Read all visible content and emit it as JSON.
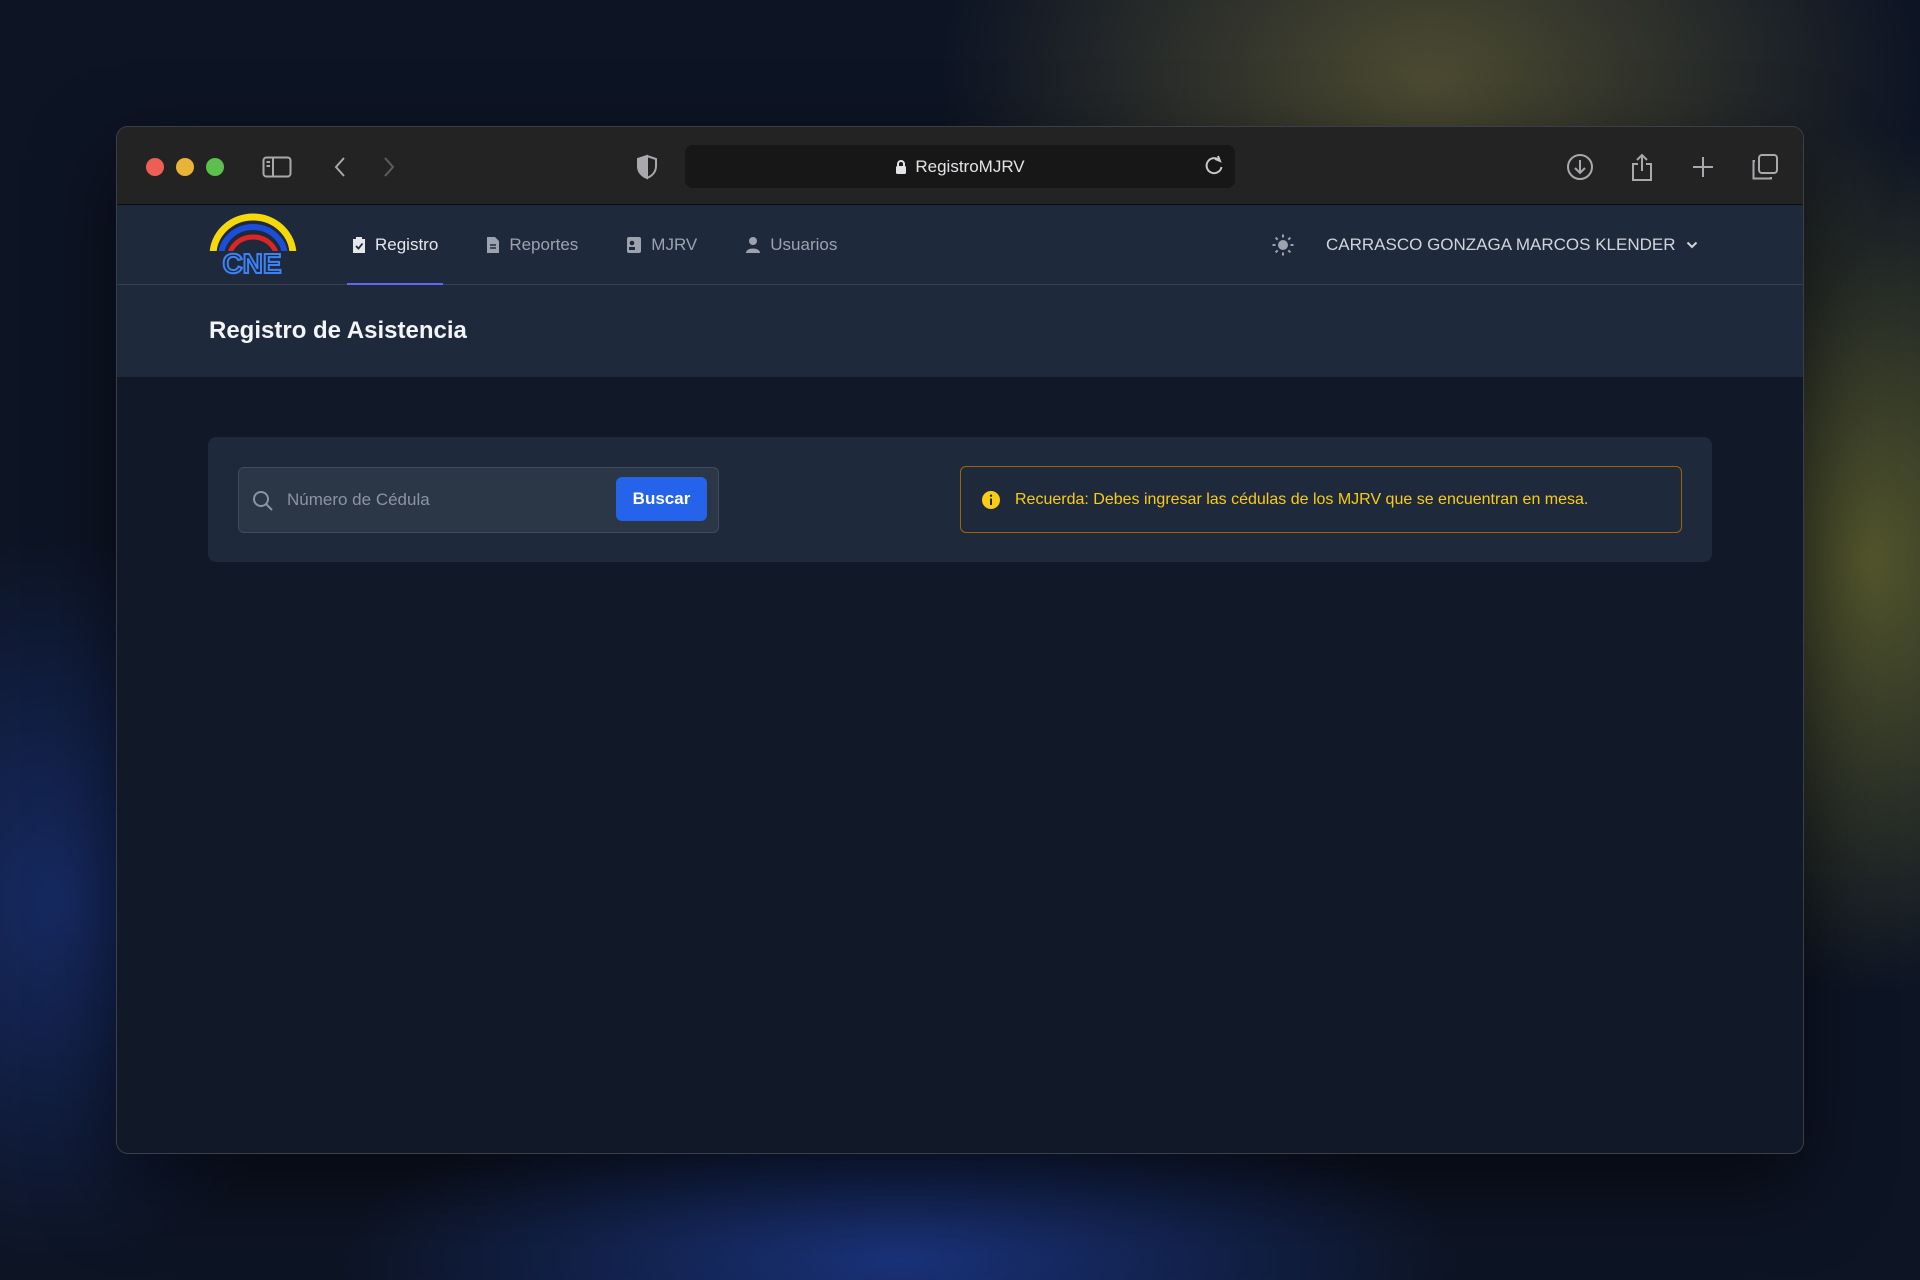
{
  "browser": {
    "url_text": "RegistroMJRV"
  },
  "logo": {
    "text": "CNE"
  },
  "nav": {
    "tabs": [
      {
        "label": "Registro",
        "icon": "clipboard-check-icon",
        "active": true
      },
      {
        "label": "Reportes",
        "icon": "document-icon",
        "active": false
      },
      {
        "label": "MJRV",
        "icon": "id-card-icon",
        "active": false
      },
      {
        "label": "Usuarios",
        "icon": "user-icon",
        "active": false
      }
    ],
    "user_name": "CARRASCO GONZAGA MARCOS KLENDER"
  },
  "page": {
    "title": "Registro de Asistencia"
  },
  "search": {
    "placeholder": "Número de Cédula",
    "value": "",
    "button_label": "Buscar"
  },
  "alert": {
    "message": "Recuerda: Debes ingresar las cédulas de los MJRV que se encuentran en mesa."
  },
  "colors": {
    "accent": "#6366f1",
    "primary_button": "#2563eb",
    "alert_text": "#facc15",
    "alert_border": "#a16207",
    "panel": "#1e293b",
    "background": "#111827"
  }
}
